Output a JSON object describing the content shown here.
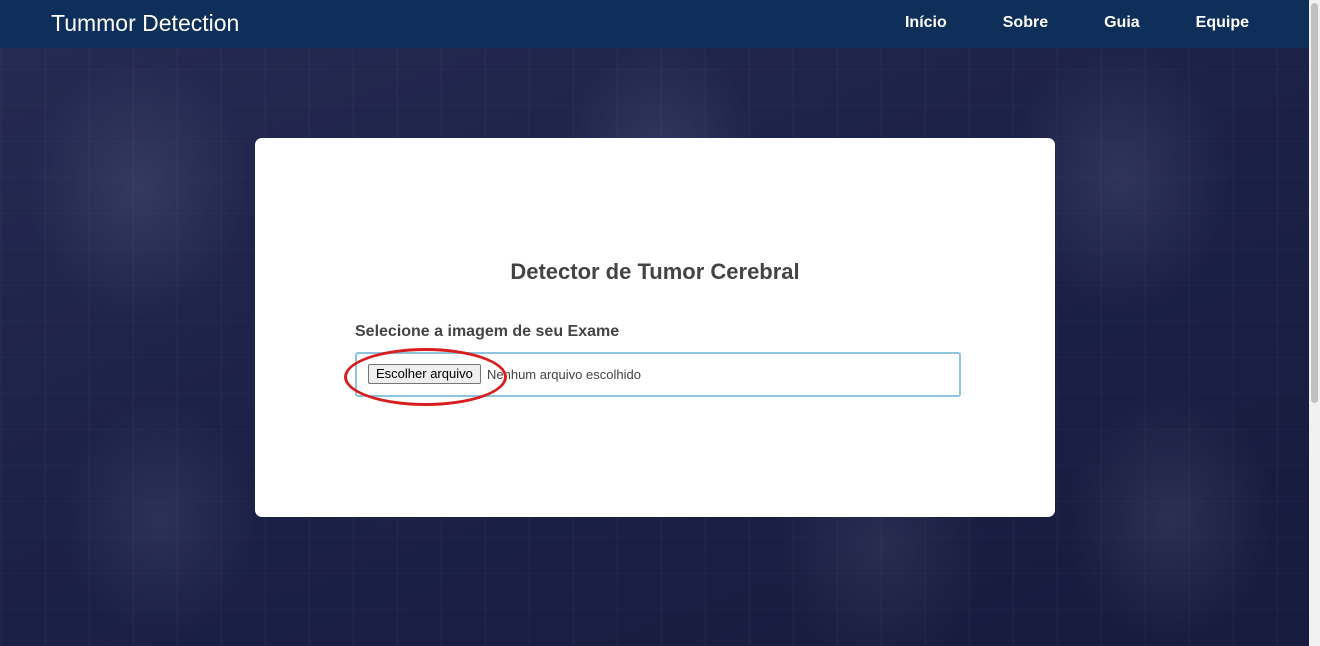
{
  "navbar": {
    "brand": "Tummor Detection",
    "links": [
      "Início",
      "Sobre",
      "Guia",
      "Equipe"
    ]
  },
  "card": {
    "title": "Detector de Tumor Cerebral",
    "field_label": "Selecione a imagem de seu Exame",
    "file_button_label": "Escolher arquivo",
    "file_status": "Nenhum arquivo escolhido"
  },
  "colors": {
    "navbar_bg": "#0e2f5a",
    "page_bg": "#1a1f45",
    "highlight": "#d81e1e",
    "input_border": "#8ec5de"
  }
}
